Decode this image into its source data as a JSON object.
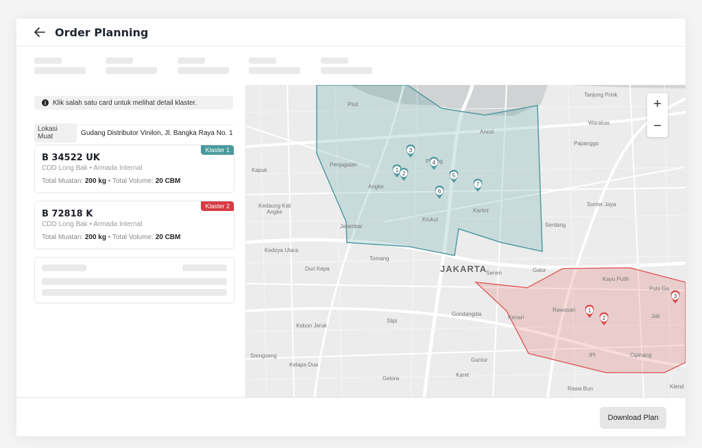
{
  "header": {
    "title": "Order Planning",
    "back_icon": "arrow-left-icon"
  },
  "sidebar": {
    "info_text": "Klik salah satu card untuk melihat detail klaster.",
    "location_label": "Lokasi Muat",
    "location_value": "Gudang Distributor Vinilon, Jl. Bangka Raya No. 1...",
    "cards": [
      {
        "plate": "B 34522 UK",
        "subtitle": "CDD Long Bak • Armada Internal",
        "total_muatan_label": "Total Muatan:",
        "total_muatan": "200 kg",
        "total_volume_label": "Total Volume:",
        "total_volume": "20 CBM",
        "badge": "Klaster 1",
        "badge_color": "#4a9a9c"
      },
      {
        "plate": "B 72818 K",
        "subtitle": "CDD Long Bak • Armada Internal",
        "total_muatan_label": "Total Muatan:",
        "total_muatan": "200 kg",
        "total_volume_label": "Total Volume:",
        "total_volume": "20 CBM",
        "badge": "Klaster 2",
        "badge_color": "#d63b45"
      }
    ]
  },
  "map": {
    "zoom_in": "+",
    "zoom_out": "−",
    "labels": {
      "tanjung_priok": "Tanjung Priok",
      "pluit": "Pluit",
      "warakas": "Warakas",
      "ancol": "Ancol",
      "papanggo": "Papanggo",
      "kapuk": "Kapuk",
      "penjagalan": "Penjagalan",
      "pinangsia": "Pinang",
      "angke": "Angke",
      "kedaung": "Kedaung Kali\nAngke",
      "sunter_jaya": "Sunter Jaya",
      "jelambar": "Jelambar",
      "krukut": "Krukut",
      "kartini": "Kartini",
      "serdang": "Serdang",
      "kedoya_utara": "Kedoya Utara",
      "tomang": "Tomang",
      "duri_kepa": "Duri Kepa",
      "jakarta": "JAKARTA",
      "senen": "Senen",
      "galur": "Galur",
      "kayu_putih": "Kayu Putih",
      "pulo_gadung": "Pulo Ga",
      "gondangdia": "Gondangdia",
      "kenari": "Kenari",
      "rawasari": "Rawasari",
      "jati": "Jati",
      "kebon_jeruk": "Kebon Jeruk",
      "slipi": "Slipi",
      "srengseng": "Srengseng",
      "kelapa_dua": "Kelapa Dua",
      "gelora": "Gelora",
      "guntur": "Guntur",
      "karet": "Karet",
      "cipinang": "Cipinang",
      "rawa_bun": "Rawa Bun",
      "klender": "Klend",
      "ipi": "IPI"
    },
    "cluster1_color": "#4f9aa0",
    "cluster2_color": "#e06060",
    "cluster1_markers": [
      "1",
      "2",
      "3",
      "4",
      "5",
      "6",
      "7"
    ],
    "cluster2_markers": [
      "1",
      "2",
      "3"
    ]
  },
  "footer": {
    "download_label": "Download Plan"
  }
}
